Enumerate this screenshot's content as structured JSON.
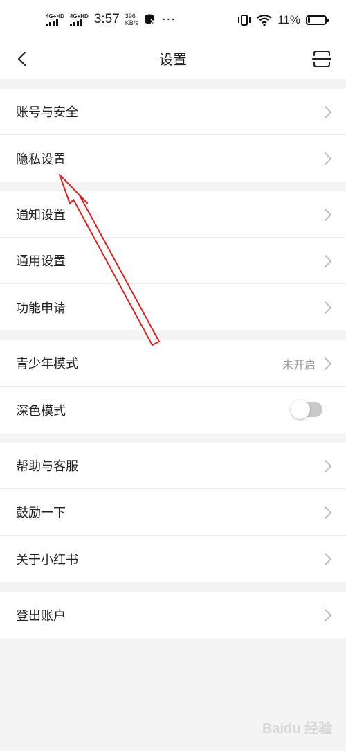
{
  "status": {
    "net1": "4G+HD",
    "net2": "4G+HD",
    "time": "3:57",
    "speed_value": "396",
    "speed_unit": "KB/s",
    "more": "···",
    "battery": "11%",
    "battery_level": 0.11
  },
  "nav": {
    "title": "设置"
  },
  "groups": [
    {
      "rows": [
        {
          "label": "账号与安全"
        },
        {
          "label": "隐私设置"
        }
      ]
    },
    {
      "rows": [
        {
          "label": "通知设置"
        },
        {
          "label": "通用设置"
        },
        {
          "label": "功能申请"
        }
      ]
    },
    {
      "rows": [
        {
          "label": "青少年模式",
          "value": "未开启"
        },
        {
          "label": "深色模式",
          "toggle": false
        }
      ]
    },
    {
      "rows": [
        {
          "label": "帮助与客服"
        },
        {
          "label": "鼓励一下"
        },
        {
          "label": "关于小红书"
        }
      ]
    },
    {
      "rows": [
        {
          "label": "登出账户"
        }
      ]
    }
  ],
  "watermark": "Baidu 经验",
  "colors": {
    "background": "#f4f4f4",
    "annotation_arrow": "#e02020"
  }
}
